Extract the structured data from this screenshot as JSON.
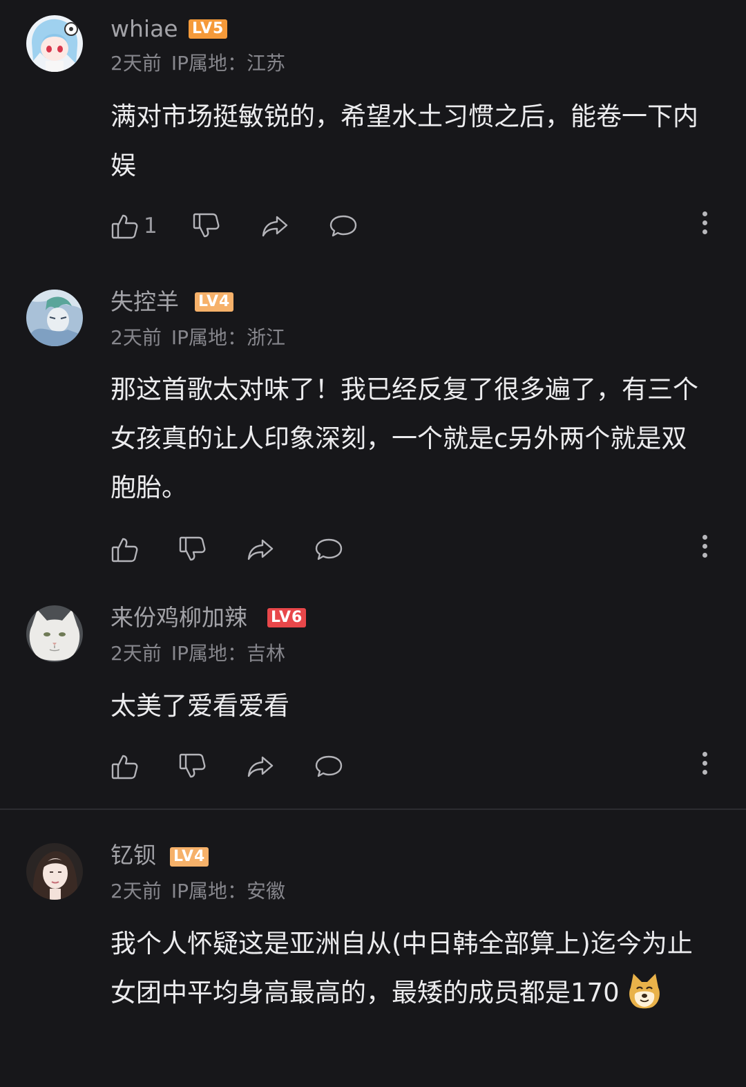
{
  "comments": [
    {
      "username": "whiae",
      "level": "LV5",
      "level_color": "#f59a3a",
      "time": "2天前",
      "ip": "IP属地：江苏",
      "content": "满对市场挺敏锐的，希望水土习惯之后，能卷一下内娱",
      "like_count": "1"
    },
    {
      "username": "失控羊",
      "level": "LV4",
      "level_color": "#f6b16a",
      "time": "2天前",
      "ip": "IP属地：浙江",
      "content": "那这首歌太对味了！我已经反复了很多遍了，有三个女孩真的让人印象深刻，一个就是c另外两个就是双胞胎。",
      "like_count": ""
    },
    {
      "username": "来份鸡柳加辣",
      "level": "LV6",
      "level_color": "#e8474a",
      "time": "2天前",
      "ip": "IP属地：吉林",
      "content": "太美了爱看爱看",
      "like_count": ""
    },
    {
      "username": "钇钡",
      "level": "LV4",
      "level_color": "#f6b16a",
      "time": "2天前",
      "ip": "IP属地：安徽",
      "content": "我个人怀疑这是亚洲自从(中日韩全部算上)迄今为止女团中平均身高最高的，最矮的成员都是170",
      "emoji": "doge-emoji"
    }
  ],
  "icons": [
    "like-icon",
    "dislike-icon",
    "share-icon",
    "reply-icon",
    "more-icon"
  ]
}
